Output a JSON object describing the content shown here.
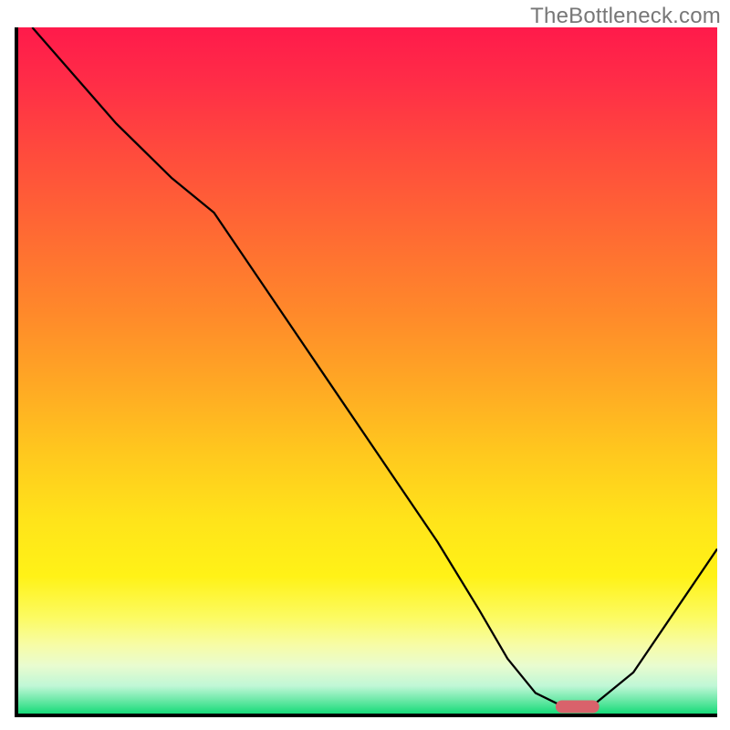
{
  "watermark": "TheBottleneck.com",
  "colors": {
    "axis": "#000000",
    "curve": "#000000",
    "marker": "#d9626b",
    "gradient_top": "#ff1a4b",
    "gradient_bottom": "#17db79"
  },
  "chart_data": {
    "type": "line",
    "title": "",
    "xlabel": "",
    "ylabel": "",
    "xlim": [
      0,
      100
    ],
    "ylim": [
      0,
      100
    ],
    "series": [
      {
        "name": "bottleneck-curve",
        "x": [
          2,
          8,
          14,
          22,
          28,
          36,
          44,
          52,
          60,
          66,
          70,
          74,
          78,
          82,
          88,
          94,
          100
        ],
        "values": [
          100,
          93,
          86,
          78,
          73,
          61,
          49,
          37,
          25,
          15,
          8,
          3,
          1,
          1,
          6,
          15,
          24
        ]
      }
    ],
    "annotations": [
      {
        "name": "optimal-marker",
        "x": 80,
        "y": 1,
        "shape": "pill"
      }
    ],
    "notes": "No numeric axis ticks or labels are visible; values are proportional estimates (0-100) read from the plot geometry."
  }
}
